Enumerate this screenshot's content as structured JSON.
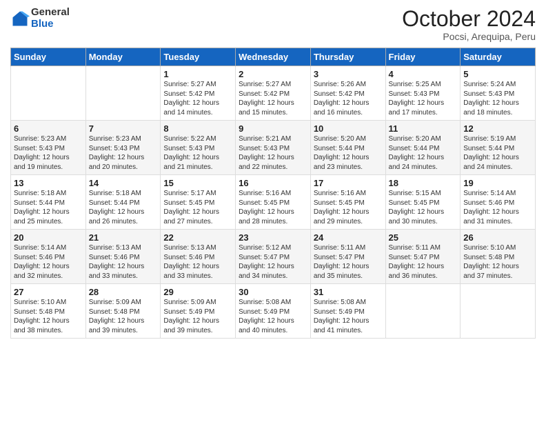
{
  "logo": {
    "general": "General",
    "blue": "Blue"
  },
  "header": {
    "title": "October 2024",
    "subtitle": "Pocsi, Arequipa, Peru"
  },
  "weekdays": [
    "Sunday",
    "Monday",
    "Tuesday",
    "Wednesday",
    "Thursday",
    "Friday",
    "Saturday"
  ],
  "weeks": [
    [
      {
        "day": "",
        "sunrise": "",
        "sunset": "",
        "daylight": ""
      },
      {
        "day": "",
        "sunrise": "",
        "sunset": "",
        "daylight": ""
      },
      {
        "day": "1",
        "sunrise": "Sunrise: 5:27 AM",
        "sunset": "Sunset: 5:42 PM",
        "daylight": "Daylight: 12 hours and 14 minutes."
      },
      {
        "day": "2",
        "sunrise": "Sunrise: 5:27 AM",
        "sunset": "Sunset: 5:42 PM",
        "daylight": "Daylight: 12 hours and 15 minutes."
      },
      {
        "day": "3",
        "sunrise": "Sunrise: 5:26 AM",
        "sunset": "Sunset: 5:42 PM",
        "daylight": "Daylight: 12 hours and 16 minutes."
      },
      {
        "day": "4",
        "sunrise": "Sunrise: 5:25 AM",
        "sunset": "Sunset: 5:43 PM",
        "daylight": "Daylight: 12 hours and 17 minutes."
      },
      {
        "day": "5",
        "sunrise": "Sunrise: 5:24 AM",
        "sunset": "Sunset: 5:43 PM",
        "daylight": "Daylight: 12 hours and 18 minutes."
      }
    ],
    [
      {
        "day": "6",
        "sunrise": "Sunrise: 5:23 AM",
        "sunset": "Sunset: 5:43 PM",
        "daylight": "Daylight: 12 hours and 19 minutes."
      },
      {
        "day": "7",
        "sunrise": "Sunrise: 5:23 AM",
        "sunset": "Sunset: 5:43 PM",
        "daylight": "Daylight: 12 hours and 20 minutes."
      },
      {
        "day": "8",
        "sunrise": "Sunrise: 5:22 AM",
        "sunset": "Sunset: 5:43 PM",
        "daylight": "Daylight: 12 hours and 21 minutes."
      },
      {
        "day": "9",
        "sunrise": "Sunrise: 5:21 AM",
        "sunset": "Sunset: 5:43 PM",
        "daylight": "Daylight: 12 hours and 22 minutes."
      },
      {
        "day": "10",
        "sunrise": "Sunrise: 5:20 AM",
        "sunset": "Sunset: 5:44 PM",
        "daylight": "Daylight: 12 hours and 23 minutes."
      },
      {
        "day": "11",
        "sunrise": "Sunrise: 5:20 AM",
        "sunset": "Sunset: 5:44 PM",
        "daylight": "Daylight: 12 hours and 24 minutes."
      },
      {
        "day": "12",
        "sunrise": "Sunrise: 5:19 AM",
        "sunset": "Sunset: 5:44 PM",
        "daylight": "Daylight: 12 hours and 24 minutes."
      }
    ],
    [
      {
        "day": "13",
        "sunrise": "Sunrise: 5:18 AM",
        "sunset": "Sunset: 5:44 PM",
        "daylight": "Daylight: 12 hours and 25 minutes."
      },
      {
        "day": "14",
        "sunrise": "Sunrise: 5:18 AM",
        "sunset": "Sunset: 5:44 PM",
        "daylight": "Daylight: 12 hours and 26 minutes."
      },
      {
        "day": "15",
        "sunrise": "Sunrise: 5:17 AM",
        "sunset": "Sunset: 5:45 PM",
        "daylight": "Daylight: 12 hours and 27 minutes."
      },
      {
        "day": "16",
        "sunrise": "Sunrise: 5:16 AM",
        "sunset": "Sunset: 5:45 PM",
        "daylight": "Daylight: 12 hours and 28 minutes."
      },
      {
        "day": "17",
        "sunrise": "Sunrise: 5:16 AM",
        "sunset": "Sunset: 5:45 PM",
        "daylight": "Daylight: 12 hours and 29 minutes."
      },
      {
        "day": "18",
        "sunrise": "Sunrise: 5:15 AM",
        "sunset": "Sunset: 5:45 PM",
        "daylight": "Daylight: 12 hours and 30 minutes."
      },
      {
        "day": "19",
        "sunrise": "Sunrise: 5:14 AM",
        "sunset": "Sunset: 5:46 PM",
        "daylight": "Daylight: 12 hours and 31 minutes."
      }
    ],
    [
      {
        "day": "20",
        "sunrise": "Sunrise: 5:14 AM",
        "sunset": "Sunset: 5:46 PM",
        "daylight": "Daylight: 12 hours and 32 minutes."
      },
      {
        "day": "21",
        "sunrise": "Sunrise: 5:13 AM",
        "sunset": "Sunset: 5:46 PM",
        "daylight": "Daylight: 12 hours and 33 minutes."
      },
      {
        "day": "22",
        "sunrise": "Sunrise: 5:13 AM",
        "sunset": "Sunset: 5:46 PM",
        "daylight": "Daylight: 12 hours and 33 minutes."
      },
      {
        "day": "23",
        "sunrise": "Sunrise: 5:12 AM",
        "sunset": "Sunset: 5:47 PM",
        "daylight": "Daylight: 12 hours and 34 minutes."
      },
      {
        "day": "24",
        "sunrise": "Sunrise: 5:11 AM",
        "sunset": "Sunset: 5:47 PM",
        "daylight": "Daylight: 12 hours and 35 minutes."
      },
      {
        "day": "25",
        "sunrise": "Sunrise: 5:11 AM",
        "sunset": "Sunset: 5:47 PM",
        "daylight": "Daylight: 12 hours and 36 minutes."
      },
      {
        "day": "26",
        "sunrise": "Sunrise: 5:10 AM",
        "sunset": "Sunset: 5:48 PM",
        "daylight": "Daylight: 12 hours and 37 minutes."
      }
    ],
    [
      {
        "day": "27",
        "sunrise": "Sunrise: 5:10 AM",
        "sunset": "Sunset: 5:48 PM",
        "daylight": "Daylight: 12 hours and 38 minutes."
      },
      {
        "day": "28",
        "sunrise": "Sunrise: 5:09 AM",
        "sunset": "Sunset: 5:48 PM",
        "daylight": "Daylight: 12 hours and 39 minutes."
      },
      {
        "day": "29",
        "sunrise": "Sunrise: 5:09 AM",
        "sunset": "Sunset: 5:49 PM",
        "daylight": "Daylight: 12 hours and 39 minutes."
      },
      {
        "day": "30",
        "sunrise": "Sunrise: 5:08 AM",
        "sunset": "Sunset: 5:49 PM",
        "daylight": "Daylight: 12 hours and 40 minutes."
      },
      {
        "day": "31",
        "sunrise": "Sunrise: 5:08 AM",
        "sunset": "Sunset: 5:49 PM",
        "daylight": "Daylight: 12 hours and 41 minutes."
      },
      {
        "day": "",
        "sunrise": "",
        "sunset": "",
        "daylight": ""
      },
      {
        "day": "",
        "sunrise": "",
        "sunset": "",
        "daylight": ""
      }
    ]
  ]
}
